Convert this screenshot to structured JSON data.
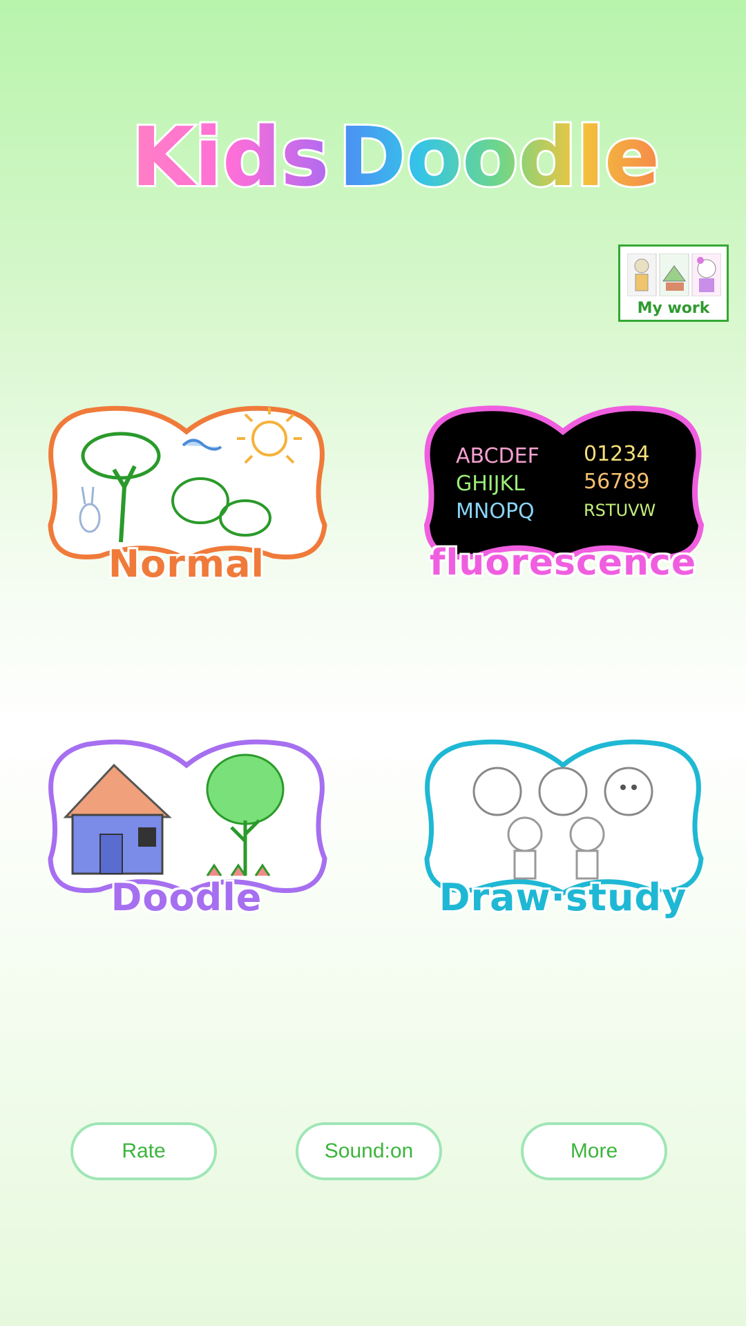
{
  "app": {
    "title_word1": "Kids",
    "title_word2": "Doodle"
  },
  "my_work": {
    "label": "My work"
  },
  "modes": [
    {
      "label": "Normal",
      "color": "#f07a3a"
    },
    {
      "label": "fluorescence",
      "color": "#f05ee0",
      "sample_letters": [
        "ABCDEF",
        "GHIJKL",
        "MNOPQ"
      ],
      "sample_digits": [
        "01234",
        "56789",
        "RSTUVW"
      ]
    },
    {
      "label": "Doodle",
      "color": "#a66ff0"
    },
    {
      "label": "Draw·study",
      "color": "#1fb8d4"
    }
  ],
  "buttons": {
    "rate": "Rate",
    "sound": "Sound:on",
    "more": "More"
  },
  "colors": {
    "accent_green": "#3cb43c",
    "button_border": "#9fe6b6"
  }
}
